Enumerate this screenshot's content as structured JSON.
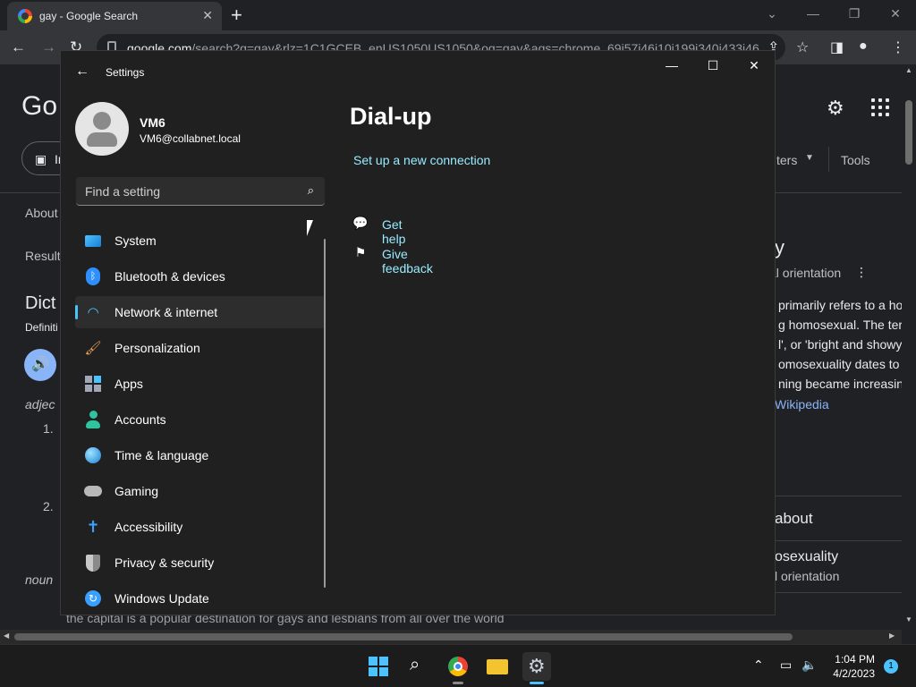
{
  "browser": {
    "tab_title": "gay - Google Search",
    "url_domain": "google.com",
    "url_path": "/search?q=gay&rlz=1C1GCEB_enUS1050US1050&oq=gay&aqs=chrome..69i57j46i10i199i340i433i46..."
  },
  "google": {
    "logo": "Go",
    "filter_chip": "Im",
    "tools": "Tools",
    "filters": "ters",
    "about": "About",
    "results": "Result",
    "dict": "Dict",
    "definitions": "Definiti",
    "adjective": "adjec",
    "noun": "noun",
    "num1": "1.",
    "num2": "2.",
    "kp_title_fragment": "y",
    "kp_subtitle": "al orientation",
    "kp_lines": [
      "primarily refers to a ho",
      "g homosexual. The terr",
      "l', or 'bright and showy'",
      "omosexuality dates to",
      "ning became increasing"
    ],
    "kp_link": "Wikipedia",
    "about_header": "about",
    "about_item_title": "osexuality",
    "about_item_sub": "l orientation",
    "example_sentence": "the capital is a popular destination for gays and lesbians from all over the world"
  },
  "settings": {
    "window_title": "Settings",
    "user_name": "VM6",
    "user_email": "VM6@collabnet.local",
    "search_placeholder": "Find a setting",
    "nav": [
      {
        "label": "System",
        "icon": "monitor-icon",
        "color": "#4cc2ff"
      },
      {
        "label": "Bluetooth & devices",
        "icon": "bluetooth-icon",
        "color": "#2f8fff"
      },
      {
        "label": "Network & internet",
        "icon": "wifi-icon",
        "color": "#4cc2ff"
      },
      {
        "label": "Personalization",
        "icon": "brush-icon",
        "color": "#e8a25a"
      },
      {
        "label": "Apps",
        "icon": "apps-icon",
        "color": "#a0a8b8"
      },
      {
        "label": "Accounts",
        "icon": "person-icon",
        "color": "#2fc4a0"
      },
      {
        "label": "Time & language",
        "icon": "globe-clock-icon",
        "color": "#4cc2ff"
      },
      {
        "label": "Gaming",
        "icon": "gamepad-icon",
        "color": "#b8b8b8"
      },
      {
        "label": "Accessibility",
        "icon": "accessibility-icon",
        "color": "#3aa0ff"
      },
      {
        "label": "Privacy & security",
        "icon": "shield-icon",
        "color": "#9aa0a6"
      },
      {
        "label": "Windows Update",
        "icon": "update-icon",
        "color": "#3aa0ff"
      }
    ],
    "selected_index": 2,
    "page_title": "Dial-up",
    "setup_link": "Set up a new connection",
    "help": "Get help",
    "feedback": "Give feedback"
  },
  "taskbar": {
    "time": "1:04 PM",
    "date": "4/2/2023",
    "notifications": "1"
  }
}
